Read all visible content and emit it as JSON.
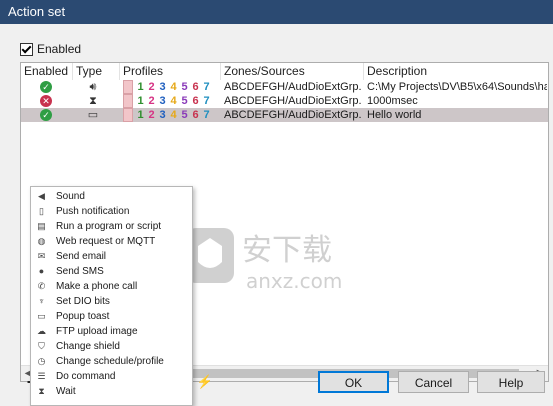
{
  "window": {
    "title": "Action set"
  },
  "enabled_checkbox": {
    "label": "Enabled",
    "checked": true
  },
  "columns": [
    "Enabled",
    "Type",
    "Profiles",
    "Zones/Sources",
    "Description"
  ],
  "profiles_digits": [
    "1",
    "2",
    "3",
    "4",
    "5",
    "6",
    "7"
  ],
  "profile_colors": [
    "#2f8f2f",
    "#d63384",
    "#1f5fbf",
    "#e6a817",
    "#8a3ab9",
    "#c8324f",
    "#1f8fbf"
  ],
  "rows": [
    {
      "enabled_icon": "check-circle-icon",
      "type_icon": "speaker-icon",
      "zones": "ABCDEFGH/AudDioExtGrp...",
      "description": "C:\\My Projects\\DV\\B5\\x64\\Sounds\\ha",
      "selected": false
    },
    {
      "enabled_icon": "x-circle-icon",
      "type_icon": "hourglass-icon",
      "zones": "ABCDEFGH/AudDioExtGrp...",
      "description": "1000msec",
      "selected": false
    },
    {
      "enabled_icon": "check-circle-icon",
      "type_icon": "monitor-icon",
      "zones": "ABCDEFGH/AudDioExtGrp...",
      "description": "Hello world",
      "selected": true
    }
  ],
  "menu_items": [
    {
      "label": "Sound",
      "icon": "speaker-icon"
    },
    {
      "label": "Push notification",
      "icon": "phone-icon"
    },
    {
      "label": "Run a program or script",
      "icon": "script-icon"
    },
    {
      "label": "Web request or MQTT",
      "icon": "globe-icon"
    },
    {
      "label": "Send email",
      "icon": "envelope-icon"
    },
    {
      "label": "Send SMS",
      "icon": "chat-icon"
    },
    {
      "label": "Make a phone call",
      "icon": "handset-icon"
    },
    {
      "label": "Set DIO bits",
      "icon": "pin-icon"
    },
    {
      "label": "Popup toast",
      "icon": "monitor-icon"
    },
    {
      "label": "FTP upload image",
      "icon": "upload-icon"
    },
    {
      "label": "Change shield",
      "icon": "shield-icon"
    },
    {
      "label": "Change schedule/profile",
      "icon": "clock-icon"
    },
    {
      "label": "Do command",
      "icon": "list-icon"
    },
    {
      "label": "Wait",
      "icon": "hourglass-icon"
    }
  ],
  "buttons": {
    "ok": "OK",
    "cancel": "Cancel",
    "help": "Help"
  },
  "watermark": {
    "cn_text": "安下载",
    "latin_text": "anxz.com"
  }
}
